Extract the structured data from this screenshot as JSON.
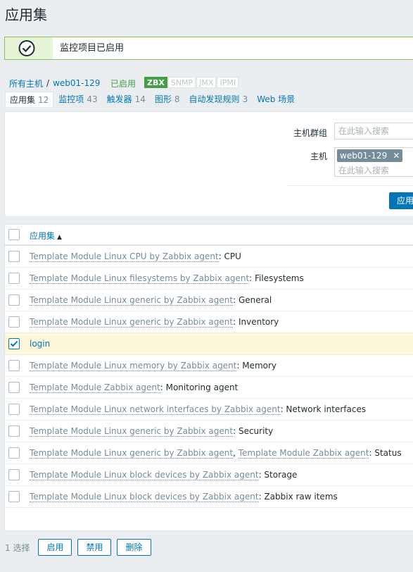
{
  "page": {
    "title": "应用集"
  },
  "message": {
    "text": "监控项目已启用"
  },
  "breadcrumb": {
    "all_hosts": "所有主机",
    "separator": "/",
    "host": "web01-129",
    "status": "已启用"
  },
  "badges": [
    "ZBX",
    "SNMP",
    "JMX",
    "IPMI"
  ],
  "tabs": [
    {
      "label": "应用集",
      "count": "12"
    },
    {
      "label": "监控项",
      "count": "43"
    },
    {
      "label": "触发器",
      "count": "14"
    },
    {
      "label": "图形",
      "count": "8"
    },
    {
      "label": "自动发现规则",
      "count": "3"
    },
    {
      "label": "Web 场景",
      "count": ""
    }
  ],
  "filter": {
    "host_group_label": "主机群组",
    "host_group_placeholder": "在此输入搜索",
    "host_label": "主机",
    "host_chip": "web01-129",
    "host_placeholder": "在此输入搜索",
    "apply_label": "应用"
  },
  "table": {
    "header": "应用集",
    "rows": [
      {
        "template": "Template Module Linux CPU by Zabbix agent",
        "name": "CPU"
      },
      {
        "template": "Template Module Linux filesystems by Zabbix agent",
        "name": "Filesystems"
      },
      {
        "template": "Template Module Linux generic by Zabbix agent",
        "name": "General"
      },
      {
        "template": "Template Module Linux generic by Zabbix agent",
        "name": "Inventory"
      },
      {
        "template": "",
        "name": "login"
      },
      {
        "template": "Template Module Linux memory by Zabbix agent",
        "name": "Memory"
      },
      {
        "template": "Template Module Zabbix agent",
        "name": "Monitoring agent"
      },
      {
        "template": "Template Module Linux network interfaces by Zabbix agent",
        "name": "Network interfaces"
      },
      {
        "template": "Template Module Linux generic by Zabbix agent",
        "name": "Security"
      },
      {
        "template": "Template Module Linux generic by Zabbix agent",
        "template2": "Template Module Zabbix agent",
        "name": "Status"
      },
      {
        "template": "Template Module Linux block devices by Zabbix agent",
        "name": "Storage"
      },
      {
        "template": "Template Module Linux block devices by Zabbix agent",
        "name": "Zabbix raw items"
      }
    ]
  },
  "footer": {
    "selected": "1 选择",
    "enable_label": "启用",
    "disable_label": "禁用",
    "delete_label": "删除"
  },
  "colors": {
    "accent": "#0275b8",
    "success": "#429e47",
    "selected_row": "#fbf7d9"
  }
}
